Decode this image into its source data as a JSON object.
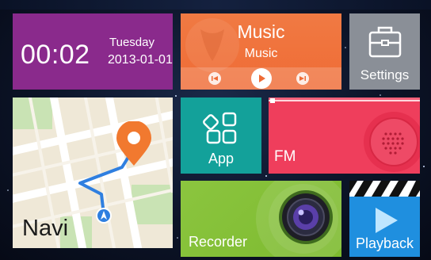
{
  "clock": {
    "time": "00:02",
    "day": "Tuesday",
    "date": "2013-01-01"
  },
  "music": {
    "title": "Music",
    "subtitle": "Music",
    "controls": [
      "previous",
      "play",
      "next"
    ]
  },
  "settings": {
    "label": "Settings",
    "icon": "toolbox-icon"
  },
  "navi": {
    "label": "Navi",
    "icons": [
      "location-pin-icon",
      "navigation-arrow-icon"
    ]
  },
  "app": {
    "label": "App",
    "icon": "apps-grid-icon"
  },
  "fm": {
    "label": "FM",
    "icon": "speaker-icon"
  },
  "recorder": {
    "label": "Recorder",
    "icon": "camera-lens-icon"
  },
  "playback": {
    "label": "Playback",
    "icon": "play-icon"
  },
  "colors": {
    "clock": "#8a2a8c",
    "music": "#f07a43",
    "settings": "#8a8f97",
    "navi": "#efe8d7",
    "app": "#13a19a",
    "fm": "#ef3e5c",
    "recorder": "#8bc53f",
    "playback": "#1f8fdf",
    "background": "#0c1428"
  }
}
